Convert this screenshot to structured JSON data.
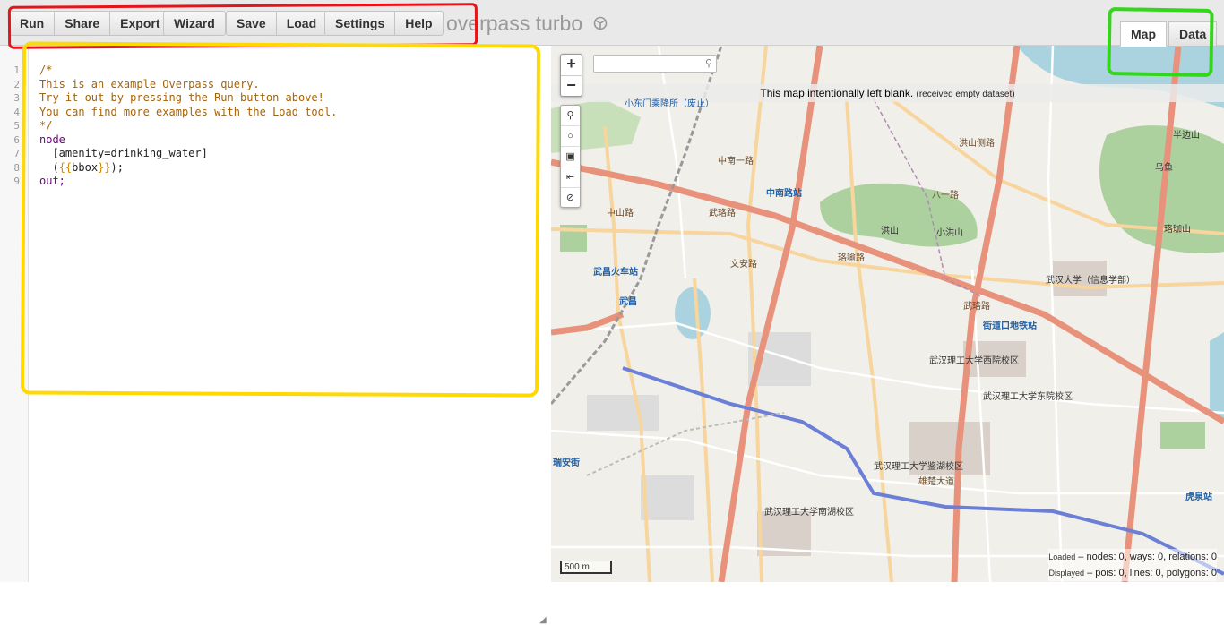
{
  "toolbar": {
    "groups": [
      [
        "Run",
        "Share",
        "Export"
      ],
      [
        "Wizard"
      ],
      [
        "Save",
        "Load"
      ],
      [
        "Settings",
        "Help"
      ]
    ],
    "run_label": "Run",
    "share_label": "Share",
    "export_label": "Export",
    "wizard_label": "Wizard",
    "save_label": "Save",
    "load_label": "Load",
    "settings_label": "Settings",
    "help_label": "Help"
  },
  "app_title": "overpass turbo",
  "view_tabs": {
    "map_label": "Map",
    "data_label": "Data",
    "active": "Map"
  },
  "editor": {
    "line_numbers": [
      "1",
      "2",
      "3",
      "4",
      "5",
      "6",
      "7",
      "8",
      "9"
    ],
    "lines": {
      "l1": "/*",
      "l2": "This is an example Overpass query.",
      "l3": "Try it out by pressing the Run button above!",
      "l4": "You can find more examples with the Load tool.",
      "l5": "*/",
      "l6": "node",
      "l7_a": "  [amenity=drinking_water]",
      "l8_open": "  (",
      "l8_tpl_open": "{{",
      "l8_word": "bbox",
      "l8_tpl_close": "}}",
      "l8_close": ");",
      "l9": "out;"
    }
  },
  "map": {
    "blank_message": "This map intentionally left blank.",
    "blank_sub": "(received empty dataset)",
    "zoom_in": "+",
    "zoom_out": "−",
    "scale_label": "500 m",
    "stats": {
      "loaded_label": "Loaded",
      "loaded_text": "– nodes: 0, ways: 0, relations: 0",
      "displayed_label": "Displayed",
      "displayed_text": "– pois: 0, lines: 0, polygons: 0"
    },
    "labels": {
      "zhongnan": "中南路站",
      "wuchang_station": "武昌火车站",
      "wuchang": "武昌",
      "jiedaokou": "街道口地铁站",
      "ruian": "瑞安街",
      "huquan": "虎泉站",
      "hongshan": "洪山",
      "xiaohongshan": "小洪山",
      "wutong_xinxi": "武汉大学（信息学部）",
      "wut_west": "武汉理工大学西院校区",
      "wut_east": "武汉理工大学东院校区",
      "wut_jianhu": "武汉理工大学鉴湖校区",
      "wut_nanhu": "武汉理工大学南湖校区",
      "wuluo_road": "武珞路",
      "luoyu_road": "珞喻路",
      "xiongchu_road": "雄楚大道",
      "bayi_road": "八一路",
      "xiaodongmen": "小东门乘降所（废止）",
      "luojia": "珞珈山",
      "hongshan_rd": "洪山侧路",
      "zhongnan_rd": "中南一路",
      "wenan": "文安路",
      "banshan": "半边山",
      "wuyu": "乌鱼",
      "zhongshan": "中山路"
    }
  },
  "colors": {
    "annotation_red": "#e3141b",
    "annotation_yellow": "#ffd900",
    "annotation_green": "#33d61a",
    "road_major": "#e8927c",
    "road_secondary": "#f7d59c",
    "water": "#aad3df",
    "park": "#add19e",
    "metro": "#6b7fd7"
  }
}
